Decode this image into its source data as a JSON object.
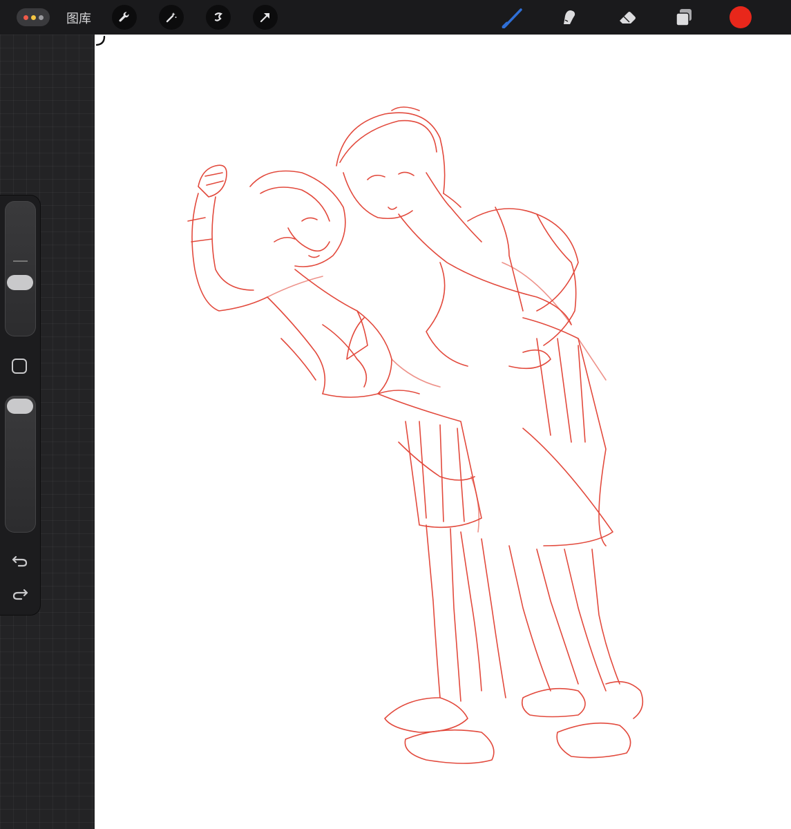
{
  "toolbar": {
    "gallery_label": "图库",
    "menu_icon": "ellipsis-icon",
    "left_tools": [
      "wrench-icon",
      "magic-wand-icon",
      "selection-icon",
      "transform-arrow-icon"
    ],
    "right_tools": [
      "brush-icon",
      "smudge-icon",
      "eraser-icon",
      "layers-icon"
    ],
    "current_color": "#e8271b",
    "brush_accent": "#2f6fd6"
  },
  "sidebar": {
    "brush_size_level": 0.38,
    "opacity_level": 1.0,
    "undo_icon": "undo-icon",
    "redo_icon": "redo-icon",
    "modify_icon": "square-modify-icon"
  },
  "canvas": {
    "background": "#ffffff",
    "stroke_color": "#e03a2c",
    "content": "sketch-drawing"
  }
}
